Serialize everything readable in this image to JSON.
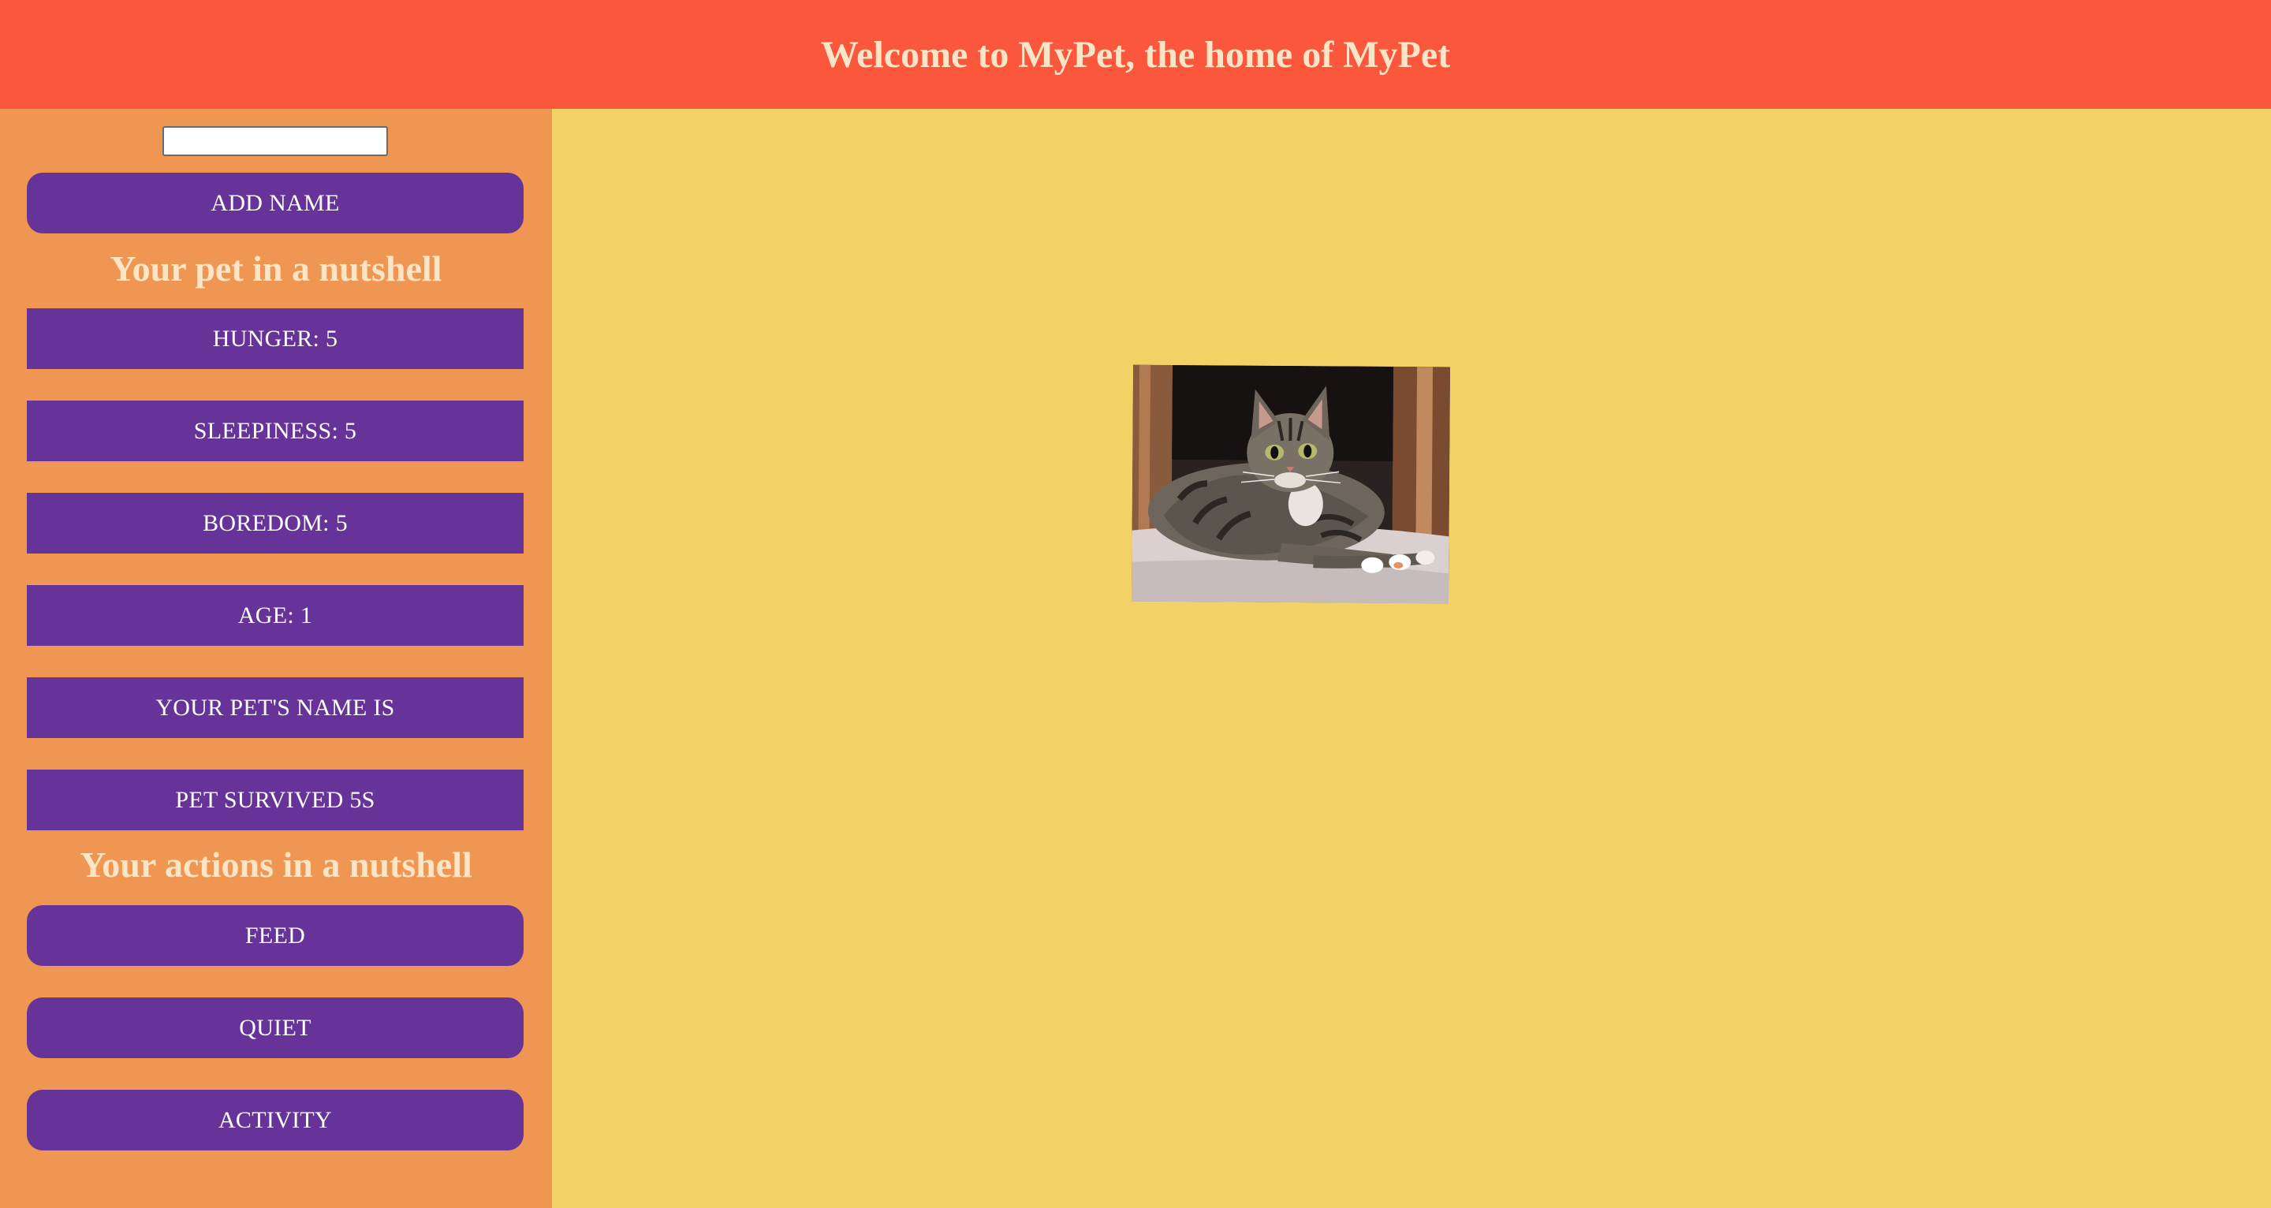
{
  "header": {
    "title": "Welcome to MyPet, the home of MyPet"
  },
  "sidebar": {
    "name_input": {
      "value": "",
      "placeholder": ""
    },
    "add_name_label": "ADD NAME",
    "stats_title": "Your pet in a nutshell",
    "stats": {
      "hunger": "HUNGER: 5",
      "sleepiness": "SLEEPINESS: 5",
      "boredom": "BOREDOM: 5",
      "age": "AGE: 1",
      "pet_name": "YOUR PET'S NAME IS",
      "survived": "PET SURVIVED 5S"
    },
    "actions_title": "Your actions in a nutshell",
    "actions": {
      "feed": "FEED",
      "quiet": "QUIET",
      "activity": "ACTIVITY"
    }
  },
  "main": {
    "pet_image_icon": "tabby-cat-photo"
  },
  "colors": {
    "header_bg": "#fa573d",
    "sidebar_bg": "#ef9752",
    "main_bg": "#f2d265",
    "button_bg": "#663399",
    "title_text": "#fbe5c6",
    "button_text": "#ffffff"
  }
}
